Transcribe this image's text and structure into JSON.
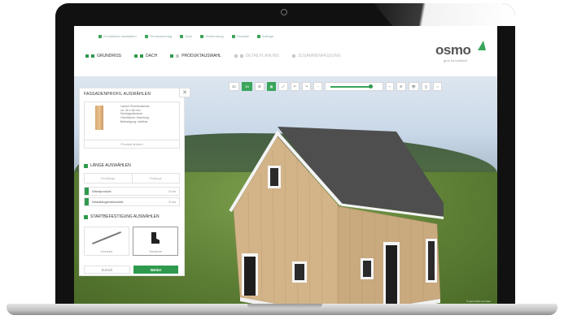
{
  "header": {
    "crumbs": [
      "Grundstück auswählen",
      "Terrassenbelag",
      "Zaun",
      "Verblendung",
      "Fassade",
      "Anfrage"
    ],
    "steps": [
      {
        "label": "GRUNDRISS",
        "active": true
      },
      {
        "label": "DACH",
        "active": true
      },
      {
        "label": "PRODUKTAUSWAHL",
        "active": true
      },
      {
        "label": "DETAILPLANUNG",
        "active": false
      },
      {
        "label": "ZUSAMMENFASSUNG",
        "active": false
      }
    ],
    "logo": {
      "text": "osmo",
      "sub": "grün ist natürlich"
    }
  },
  "toolbar": {
    "items": [
      "2D",
      "3D",
      "⊞",
      "▦",
      "⤢",
      "↶",
      "↷",
      "−",
      "+",
      "⚙",
      "👁",
      "◫",
      "⌂"
    ]
  },
  "panel": {
    "title": "FASSADENPROFIL AUSWÄHLEN",
    "close": "✕",
    "product": {
      "info": [
        "Lärche Rhombusleiste",
        "ca. 26 x 68 mm",
        "Montageabstand",
        "Oberfläche: Hobelung",
        "Befestigung: sichtbar"
      ],
      "button": "Produkt ändern"
    },
    "length_title": "LÄNGE AUSWÄHLEN",
    "tabs": [
      "Festlänge",
      "Fixlänge"
    ],
    "rows": [
      {
        "label": "Wandprodukt",
        "unit": "5 cm"
      },
      {
        "label": "Wandlängenabschnitt",
        "unit": "5 cm"
      }
    ],
    "fixing_title": "STARTBEFESTIGUNG AUSWÄHLEN",
    "fixings": [
      {
        "label": "Schraube",
        "selected": false
      },
      {
        "label": "Startleiste",
        "selected": true
      }
    ],
    "back": "Zurück",
    "next": "Weiter"
  },
  "viewport": {
    "credit": "© osmo holz und color"
  },
  "colors": {
    "accent": "#2f9a4e",
    "roof": "#505050",
    "wood": "#c9a97e"
  }
}
